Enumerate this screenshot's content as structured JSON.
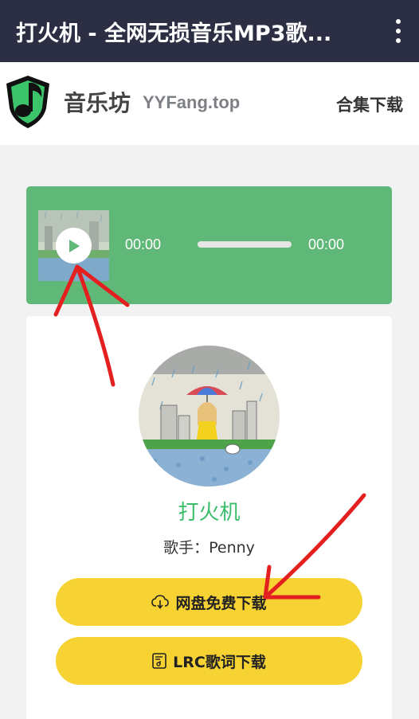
{
  "topbar": {
    "title": "打火机 - 全网无损音乐MP3歌...",
    "menu_icon": "kebab-menu-icon"
  },
  "site": {
    "logo_icon": "music-note-shield-logo",
    "name": "音乐坊",
    "domain": "YYFang.top",
    "collection_link": "合集下载"
  },
  "player": {
    "current_time": "00:00",
    "duration": "00:00",
    "progress": 0,
    "play_icon": "play-icon"
  },
  "song": {
    "title": "打火机",
    "artist_line": "歌手：Penny"
  },
  "buttons": {
    "cloud_download": {
      "label": "网盘免费下载",
      "icon": "cloud-download-icon"
    },
    "lrc_download": {
      "label": "LRC歌词下载",
      "icon": "lyrics-file-icon"
    }
  },
  "colors": {
    "topbar_bg": "#2c2e43",
    "player_bg": "#5fb878",
    "title_green": "#3cbd6a",
    "button_yellow": "#f7d233",
    "annotation_red": "#e3201f"
  }
}
